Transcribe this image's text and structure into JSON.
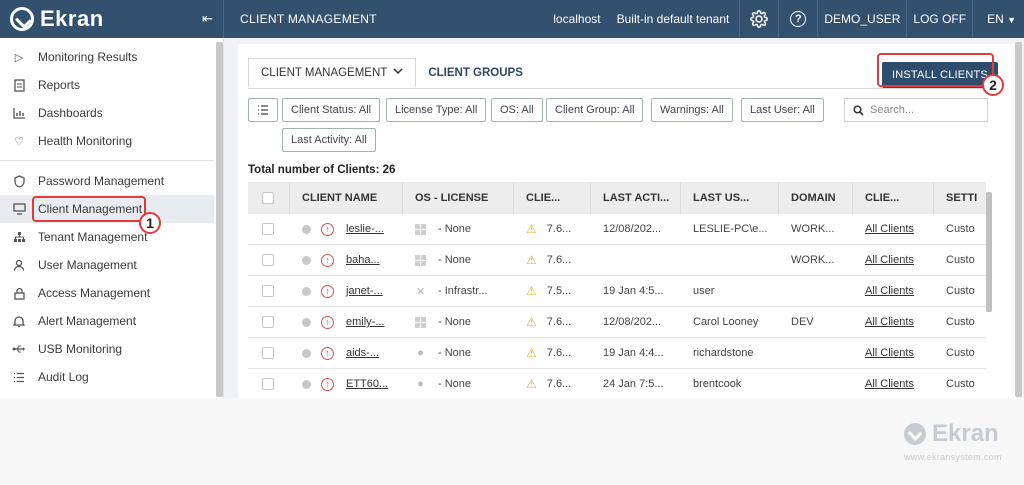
{
  "topbar": {
    "logo": "Ekran",
    "page_title": "CLIENT MANAGEMENT",
    "host": "localhost",
    "tenant": "Built-in default tenant",
    "user": "DEMO_USER",
    "logoff": "LOG OFF",
    "language": "EN"
  },
  "sidebar": {
    "items": [
      {
        "label": "Monitoring Results",
        "icon": "play-icon"
      },
      {
        "label": "Reports",
        "icon": "report-icon"
      },
      {
        "label": "Dashboards",
        "icon": "chart-icon"
      },
      {
        "label": "Health Monitoring",
        "icon": "heart-icon"
      },
      {
        "label": "Password Management",
        "icon": "shield-icon"
      },
      {
        "label": "Client Management",
        "icon": "monitor-icon"
      },
      {
        "label": "Tenant Management",
        "icon": "network-icon"
      },
      {
        "label": "User Management",
        "icon": "user-icon"
      },
      {
        "label": "Access Management",
        "icon": "lock-icon"
      },
      {
        "label": "Alert Management",
        "icon": "bell-icon"
      },
      {
        "label": "USB Monitoring",
        "icon": "usb-icon"
      },
      {
        "label": "Audit Log",
        "icon": "list-icon"
      }
    ]
  },
  "tabs": {
    "client_management": "CLIENT MANAGEMENT",
    "client_groups": "CLIENT GROUPS"
  },
  "install_button": "INSTALL CLIENTS",
  "annotations": {
    "one": "1",
    "two": "2"
  },
  "filters": {
    "client_status": "Client Status: All",
    "license_type": "License Type: All",
    "os": "OS: All",
    "client_group": "Client Group: All",
    "warnings": "Warnings: All",
    "last_user": "Last User: All",
    "last_activity": "Last Activity: All"
  },
  "search": {
    "placeholder": "Search..."
  },
  "total": "Total number of Clients: 26",
  "table": {
    "headers": [
      "CLIENT NAME",
      "OS - LICENSE",
      "CLIE...",
      "LAST ACTI...",
      "LAST US...",
      "DOMAIN",
      "CLIE...",
      "SETTI"
    ],
    "rows": [
      {
        "name": "leslie-...",
        "os": "windows",
        "license": "- None",
        "version": "7.6...",
        "last_activity": "12/08/202...",
        "last_user": "LESLIE-PC\\e...",
        "domain": "WORK...",
        "group": "All Clients",
        "settings": "Custo"
      },
      {
        "name": "baha...",
        "os": "windows",
        "license": "- None",
        "version": "7.6...",
        "last_activity": "",
        "last_user": "",
        "domain": "WORK...",
        "group": "All Clients",
        "settings": "Custo"
      },
      {
        "name": "janet-...",
        "os": "x",
        "license": "- Infrastr...",
        "version": "7.5...",
        "last_activity": "19 Jan 4:5...",
        "last_user": "user",
        "domain": "",
        "group": "All Clients",
        "settings": "Custo"
      },
      {
        "name": "emily-...",
        "os": "windows",
        "license": "- None",
        "version": "7.6...",
        "last_activity": "12/08/202...",
        "last_user": "Carol Looney",
        "domain": "DEV",
        "group": "All Clients",
        "settings": "Custo"
      },
      {
        "name": "aids-...",
        "os": "apple",
        "license": "- None",
        "version": "7.6...",
        "last_activity": "19 Jan 4:4...",
        "last_user": "richardstone",
        "domain": "",
        "group": "All Clients",
        "settings": "Custo"
      },
      {
        "name": "ETT60...",
        "os": "apple",
        "license": "- None",
        "version": "7.6...",
        "last_activity": "24 Jan 7:5...",
        "last_user": "brentcook",
        "domain": "",
        "group": "All Clients",
        "settings": "Custo"
      }
    ]
  },
  "watermark": {
    "logo": "Ekran",
    "url": "www.ekransystem.com"
  },
  "colors": {
    "topbar": "#33506f",
    "accent_button": "#2e4c6c",
    "annotation": "#e03c3c",
    "warning": "#e4b214",
    "upgrade": "#e05050"
  }
}
